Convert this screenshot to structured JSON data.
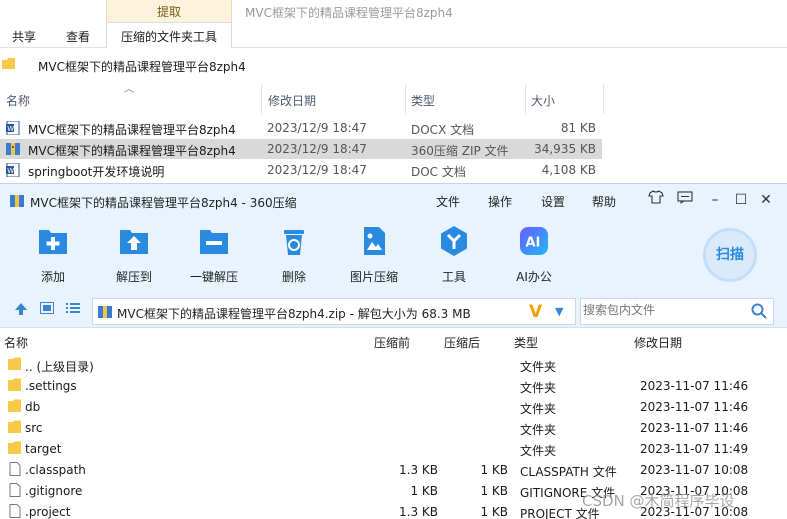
{
  "explorer": {
    "ribbon": {
      "tab_share": "共享",
      "tab_view": "查看",
      "context_group": "提取",
      "context_tab": "压缩的文件夹工具",
      "window_title": "MVC框架下的精品课程管理平台8zph4"
    },
    "address": "MVC框架下的精品课程管理平台8zph4",
    "columns": {
      "name": "名称",
      "modified": "修改日期",
      "type": "类型",
      "size": "大小"
    },
    "files": [
      {
        "name": "MVC框架下的精品课程管理平台8zph4",
        "modified": "2023/12/9 18:47",
        "type": "DOCX 文档",
        "size": "81 KB",
        "icon": "word-doc-icon"
      },
      {
        "name": "MVC框架下的精品课程管理平台8zph4",
        "modified": "2023/12/9 18:47",
        "type": "360压缩 ZIP 文件",
        "size": "34,935 KB",
        "icon": "zip-archive-icon"
      },
      {
        "name": "springboot开发环境说明",
        "modified": "2023/12/9 18:47",
        "type": "DOC 文档",
        "size": "4,108 KB",
        "icon": "word-doc-icon"
      }
    ]
  },
  "zip": {
    "title": "MVC框架下的精品课程管理平台8zph4 - 360压缩",
    "menu": [
      "文件",
      "操作",
      "设置",
      "帮助"
    ],
    "toolbar": [
      {
        "label": "添加",
        "icon": "add-icon"
      },
      {
        "label": "解压到",
        "icon": "extract-to-icon"
      },
      {
        "label": "一键解压",
        "icon": "one-click-extract-icon"
      },
      {
        "label": "删除",
        "icon": "delete-icon"
      },
      {
        "label": "图片压缩",
        "icon": "image-compress-icon"
      },
      {
        "label": "工具",
        "icon": "tools-icon"
      },
      {
        "label": "AI办公",
        "icon": "ai-office-icon"
      }
    ],
    "scan_label": "扫描",
    "path_text": "MVC框架下的精品课程管理平台8zph4.zip - 解包大小为 68.3 MB",
    "search_placeholder": "搜索包内文件",
    "columns": {
      "name": "名称",
      "compressed": "压缩前",
      "after": "压缩后",
      "type": "类型",
      "modified": "修改日期"
    },
    "rows": [
      {
        "name": ".. (上级目录)",
        "before": "",
        "after": "",
        "type": "文件夹",
        "modified": "",
        "kind": "folder"
      },
      {
        "name": ".settings",
        "before": "",
        "after": "",
        "type": "文件夹",
        "modified": "2023-11-07 11:46",
        "kind": "folder"
      },
      {
        "name": "db",
        "before": "",
        "after": "",
        "type": "文件夹",
        "modified": "2023-11-07 11:46",
        "kind": "folder"
      },
      {
        "name": "src",
        "before": "",
        "after": "",
        "type": "文件夹",
        "modified": "2023-11-07 11:46",
        "kind": "folder"
      },
      {
        "name": "target",
        "before": "",
        "after": "",
        "type": "文件夹",
        "modified": "2023-11-07 11:49",
        "kind": "folder"
      },
      {
        "name": ".classpath",
        "before": "1.3 KB",
        "after": "1 KB",
        "type": "CLASSPATH 文件",
        "modified": "2023-11-07 10:08",
        "kind": "file"
      },
      {
        "name": ".gitignore",
        "before": "1 KB",
        "after": "1 KB",
        "type": "GITIGNORE 文件",
        "modified": "2023-11-07 10:08",
        "kind": "file"
      },
      {
        "name": ".project",
        "before": "1.3 KB",
        "after": "1 KB",
        "type": "PROJECT 文件",
        "modified": "2023-11-07 10:08",
        "kind": "file"
      }
    ]
  },
  "watermark": "CSDN @木简程序毕设",
  "colors": {
    "zip_accent": "#2a8ae0",
    "zip_bg": "#e9f3fd",
    "folder": "#f7c948",
    "selected_row": "#d9d9d9"
  }
}
